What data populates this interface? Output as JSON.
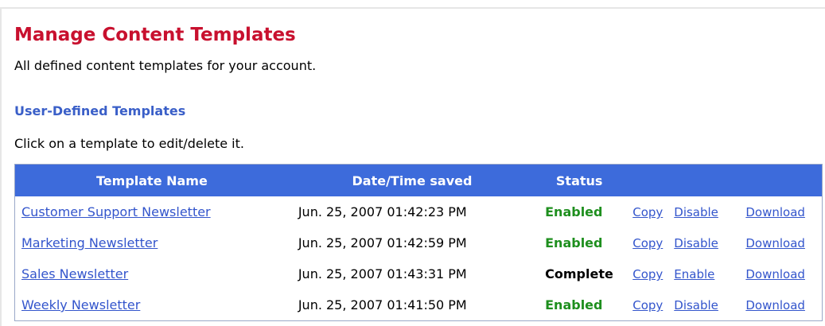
{
  "header": {
    "title": "Manage Content Templates",
    "subtitle": "All defined content templates for your account."
  },
  "section": {
    "heading": "User-Defined Templates",
    "instructions": "Click on a template to edit/delete it."
  },
  "table": {
    "columns": [
      "Template Name",
      "Date/Time saved",
      "Status"
    ],
    "rows": [
      {
        "name": "Customer Support Newsletter",
        "saved": "Jun. 25, 2007 01:42:23 PM",
        "status": "Enabled",
        "status_kind": "enabled",
        "copy": "Copy",
        "toggle": "Disable",
        "download": "Download"
      },
      {
        "name": "Marketing Newsletter",
        "saved": "Jun. 25, 2007 01:42:59 PM",
        "status": "Enabled",
        "status_kind": "enabled",
        "copy": "Copy",
        "toggle": "Disable",
        "download": "Download"
      },
      {
        "name": "Sales Newsletter",
        "saved": "Jun. 25, 2007 01:43:31 PM",
        "status": "Complete",
        "status_kind": "complete",
        "copy": "Copy",
        "toggle": "Enable",
        "download": "Download"
      },
      {
        "name": "Weekly Newsletter",
        "saved": "Jun. 25, 2007 01:41:50 PM",
        "status": "Enabled",
        "status_kind": "enabled",
        "copy": "Copy",
        "toggle": "Disable",
        "download": "Download"
      }
    ]
  },
  "colors": {
    "title": "#c8102e",
    "section_heading": "#3a5fc8",
    "header_bg": "#3d6bdb",
    "status_enabled": "#1e8f1e",
    "link": "#3355cc"
  }
}
